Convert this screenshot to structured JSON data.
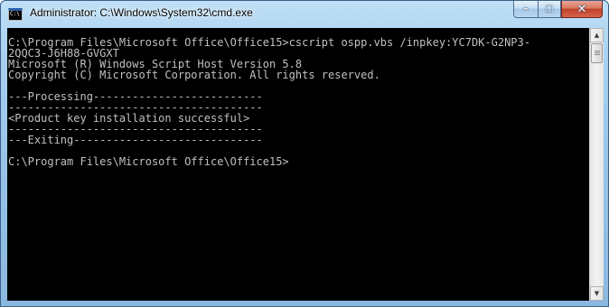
{
  "window": {
    "title": "Administrator: C:\\Windows\\System32\\cmd.exe",
    "icon_text": "C:\\",
    "controls": {
      "minimize": "–",
      "maximize": "☐",
      "close": "✕"
    }
  },
  "console": {
    "text": "C:\\Program Files\\Microsoft Office\\Office15>cscript ospp.vbs /inpkey:YC7DK-G2NP3-\n2QQC3-J6H88-GVGXT\nMicrosoft (R) Windows Script Host Version 5.8\nCopyright (C) Microsoft Corporation. All rights reserved.\n\n---Processing--------------------------\n---------------------------------------\n<Product key installation successful>\n---------------------------------------\n---Exiting-----------------------------\n\nC:\\Program Files\\Microsoft Office\\Office15>"
  },
  "scrollbar": {
    "up_arrow": "▲",
    "down_arrow": "▼"
  },
  "colors": {
    "console_background": "#000000",
    "console_text": "#c0c0c0",
    "close_button": "#c2412a",
    "window_frame": "#96c3e7"
  }
}
